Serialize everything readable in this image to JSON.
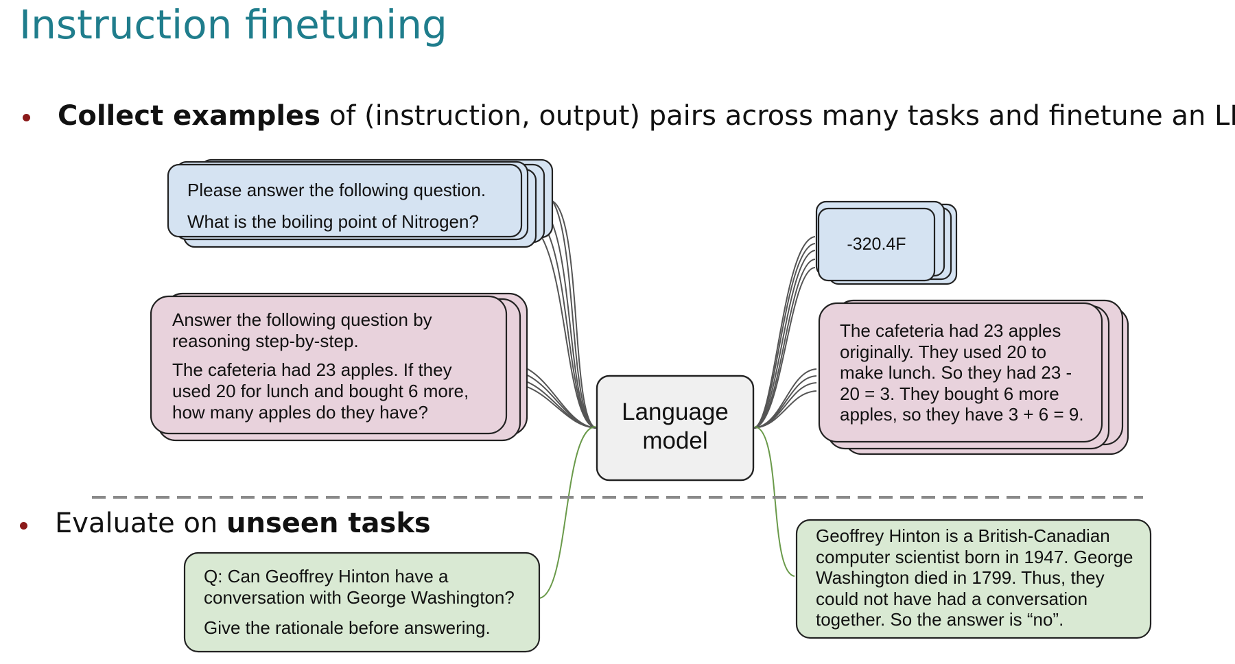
{
  "slide": {
    "title": "Instruction finetuning"
  },
  "bullets": {
    "first": {
      "bold": "Collect examples",
      "rest": " of (instruction, output) pairs across many tasks and finetune an LM"
    },
    "second": {
      "plain": "Evaluate on ",
      "bold": "unseen tasks"
    }
  },
  "inputs": {
    "qa": {
      "lines": [
        "Please answer the following question.",
        "What is the boiling point of Nitrogen?"
      ]
    },
    "cot": {
      "para1": [
        "Answer the following question by",
        "reasoning step-by-step."
      ],
      "para2": [
        "The cafeteria had 23 apples. If they",
        "used 20 for lunch and bought 6 more,",
        "how many apples do they have?"
      ]
    },
    "unseen": {
      "para1": [
        "Q: Can Geoffrey Hinton have a",
        "conversation with George Washington?"
      ],
      "para2": [
        "Give the rationale before answering."
      ]
    }
  },
  "model": {
    "lines": [
      "Language",
      "model"
    ]
  },
  "outputs": {
    "qa": {
      "text": "-320.4F"
    },
    "cot": {
      "lines": [
        "The cafeteria had 23 apples",
        "originally. They used 20 to",
        "make lunch. So they had 23 -",
        "20 = 3. They bought 6 more",
        "apples, so they have 3 + 6 = 9."
      ]
    },
    "unseen": {
      "lines": [
        "Geoffrey Hinton is a British-Canadian",
        "computer scientist born in 1947. George",
        "Washington died in 1799. Thus, they",
        "could not have had a conversation",
        "together. So the answer is “no”."
      ]
    }
  },
  "colors": {
    "title": "#1f7d8c",
    "bullet": "#8b1a1a",
    "blue_box": "#d5e3f2",
    "pink_box": "#e8d2dc",
    "green_box": "#d9e9d3",
    "model_box": "#f0f0f0",
    "seen_connector": "#555555",
    "unseen_connector": "#6a9a4a",
    "divider": "#8a8a8a"
  }
}
